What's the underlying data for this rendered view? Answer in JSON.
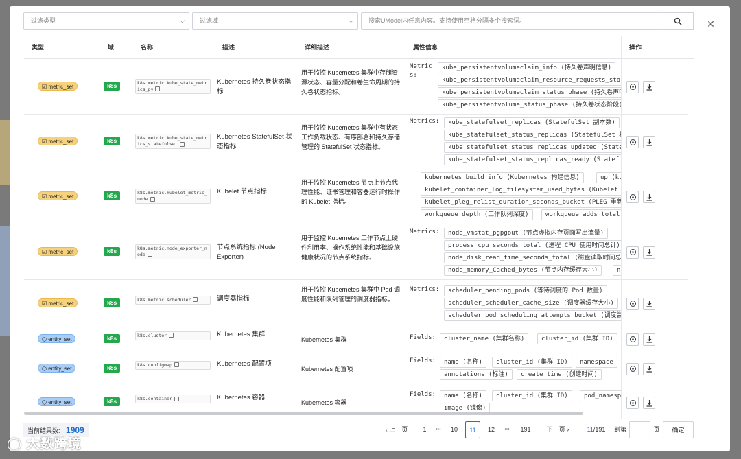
{
  "filters": {
    "type_placeholder": "过滤类型",
    "domain_placeholder": "过滤域",
    "search_placeholder": "搜索UModel内任意内容。支持使用空格分隔多个搜索词。"
  },
  "columns": {
    "type": "类型",
    "domain": "域",
    "name": "名称",
    "desc": "描述",
    "detail": "详细描述",
    "attrs": "属性信息",
    "ops": "操作"
  },
  "rows": [
    {
      "type": "metric_set",
      "domain": "k8s",
      "name": "k8s.metric.kube_state_metrics_pv",
      "desc": "Kubernetes 持久卷状态指标",
      "detail": "用于监控 Kubernetes 集群中存储资源状态、容量分配和卷生命周期的持久卷状态指标。",
      "attr_label": "Metrics:",
      "tags": [
        "kube_persistentvolumeclaim_info (持久卷声明信息)",
        "kube_persistentvolumeclaim_resource_requests_storage_bytes",
        "kube_persistentvolumeclaim_status_phase (持久卷声明状态)",
        "kube_persistentvolume_status_phase (持久卷状态阶段)"
      ]
    },
    {
      "type": "metric_set",
      "domain": "k8s",
      "name": "k8s.metric.kube_state_metrics_statefulset",
      "desc": "Kubernetes StatefulSet 状态指标",
      "detail": "用于监控 Kubernetes 集群中有状态工作负载状态、有序部署和持久存储管理的 StatefulSet 状态指标。",
      "attr_label": "Metrics:",
      "tags": [
        "kube_statefulset_replicas (StatefulSet 副本数)",
        "kube_statefulset_status_replicas (StatefulSet 状态副本数)",
        "kube_statefulset_status_replicas_updated (StatefulSet 更新副本数)",
        "kube_statefulset_status_replicas_ready (StatefulSet 就绪副本数)"
      ]
    },
    {
      "type": "metric_set",
      "domain": "k8s",
      "name": "k8s.metric.kubelet_metric_node",
      "desc": "Kubelet 节点指标",
      "detail": "用于监控 Kubernetes 节点上节点代理性能、证书管理和容器运行时操作的 Kubelet 指标。",
      "attr_label": "",
      "tags": [
        "kubernetes_build_info (Kubernetes 构建信息)",
        "up (kubelet 在线状态)",
        "kubelet_container_log_filesystem_used_bytes (Kubelet 容器日志使用)",
        "kubelet_pleg_relist_duration_seconds_bucket (PLEG 重新列出时长)",
        "workqueue_depth (工作队列深度)",
        "workqueue_adds_total (工作队列添加总数)"
      ]
    },
    {
      "type": "metric_set",
      "domain": "k8s",
      "name": "k8s.metric.node_exporter_node",
      "desc": "节点系统指标 (Node Exporter)",
      "detail": "用于监控 Kubernetes 工作节点上硬件利用率、操作系统性能和基础设施健康状况的节点系统指标。",
      "attr_label": "Metrics:",
      "tags": [
        "node_vmstat_pgpgout (节点虚拟内存页面写出流量)",
        "process_cpu_seconds_total (进程 CPU 使用时间总计)",
        "node_disk_read_time_seconds_total (磁盘读取时间总计)",
        "node_memory_Cached_bytes (节点内存缓存大小)",
        "node_memory_MemFree"
      ]
    },
    {
      "type": "metric_set",
      "domain": "k8s",
      "name": "k8s.metric.scheduler",
      "desc": "调度器指标",
      "detail": "用于监控 Kubernetes 集群中 Pod 调度性能和队列管理的调度器指标。",
      "attr_label": "Metrics:",
      "tags": [
        "scheduler_pending_pods (等待调度的 Pod 数量)",
        "scheduler_scheduler_cache_size (调度器缓存大小)",
        "scheduler_pod_scheduling_attempts_bucket (调度尝试次数)"
      ]
    },
    {
      "type": "entity_set",
      "domain": "k8s",
      "name": "k8s.cluster",
      "desc": "Kubernetes 集群",
      "detail": "Kubernetes 集群",
      "attr_label": "Fields:",
      "tags": [
        "cluster_name (集群名称)",
        "cluster_id (集群 ID)"
      ]
    },
    {
      "type": "entity_set",
      "domain": "k8s",
      "name": "k8s.configmap",
      "desc": "Kubernetes 配置项",
      "detail": "Kubernetes 配置项",
      "attr_label": "Fields:",
      "tags": [
        "name (名称)",
        "cluster_id (集群 ID)",
        "namespace",
        "annotations (标注)",
        "create_time (创建时间)"
      ]
    },
    {
      "type": "entity_set",
      "domain": "k8s",
      "name": "k8s.container",
      "desc": "Kubernetes 容器",
      "detail": "Kubernetes 容器",
      "attr_label": "Fields:",
      "tags": [
        "name (名称)",
        "cluster_id (集群 ID)",
        "pod_namespace",
        "image (镜像)"
      ]
    }
  ],
  "footer": {
    "result_label": "当前结果数:",
    "result_count": "1909",
    "prev": "上一页",
    "next": "下一页",
    "pages": [
      "1",
      "10",
      "11",
      "12",
      "191"
    ],
    "ellipsis": "•••",
    "current": "11",
    "total": "/191",
    "goto_label": "到第",
    "page_unit": "页",
    "confirm": "确定"
  },
  "watermark": "大数跨境"
}
